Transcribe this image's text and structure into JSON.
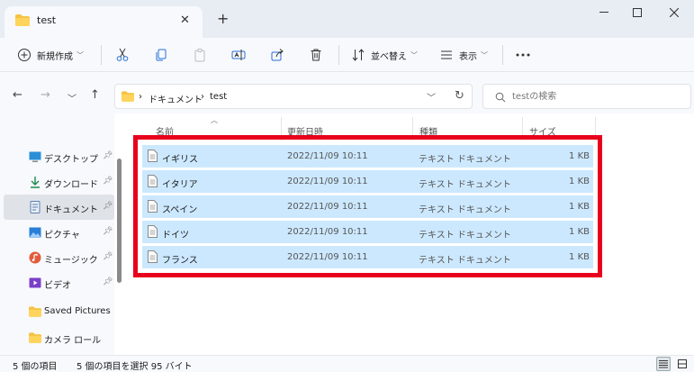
{
  "window": {
    "tab_title": "test"
  },
  "toolbar": {
    "new_label": "新規作成",
    "sort_label": "並べ替え",
    "view_label": "表示"
  },
  "address": {
    "crumbs": [
      "ドキュメント",
      "test"
    ],
    "search_placeholder": "testの検索"
  },
  "sidebar": {
    "items": [
      {
        "label": "デスクトップ",
        "icon": "desktop-icon",
        "pinned": true
      },
      {
        "label": "ダウンロード",
        "icon": "download-icon",
        "pinned": true
      },
      {
        "label": "ドキュメント",
        "icon": "document-icon",
        "pinned": true
      },
      {
        "label": "ピクチャ",
        "icon": "pictures-icon",
        "pinned": true
      },
      {
        "label": "ミュージック",
        "icon": "music-icon",
        "pinned": true
      },
      {
        "label": "ビデオ",
        "icon": "video-icon",
        "pinned": true
      },
      {
        "label": "Saved Pictures",
        "icon": "folder-icon",
        "pinned": false
      },
      {
        "label": "カメラ ロール",
        "icon": "folder-icon",
        "pinned": false
      }
    ]
  },
  "columns": {
    "name": "名前",
    "modified": "更新日時",
    "type": "種類",
    "size": "サイズ"
  },
  "files": [
    {
      "name": "イギリス",
      "modified": "2022/11/09 10:11",
      "type": "テキスト ドキュメント",
      "size": "1 KB"
    },
    {
      "name": "イタリア",
      "modified": "2022/11/09 10:11",
      "type": "テキスト ドキュメント",
      "size": "1 KB"
    },
    {
      "name": "スペイン",
      "modified": "2022/11/09 10:11",
      "type": "テキスト ドキュメント",
      "size": "1 KB"
    },
    {
      "name": "ドイツ",
      "modified": "2022/11/09 10:11",
      "type": "テキスト ドキュメント",
      "size": "1 KB"
    },
    {
      "name": "フランス",
      "modified": "2022/11/09 10:11",
      "type": "テキスト ドキュメント",
      "size": "1 KB"
    }
  ],
  "status": {
    "item_count": "5 個の項目",
    "selection": "5 個の項目を選択 95 バイト"
  },
  "colors": {
    "selection": "#cce8ff",
    "highlight_border": "#e8001c",
    "folder": "#f5c342"
  }
}
